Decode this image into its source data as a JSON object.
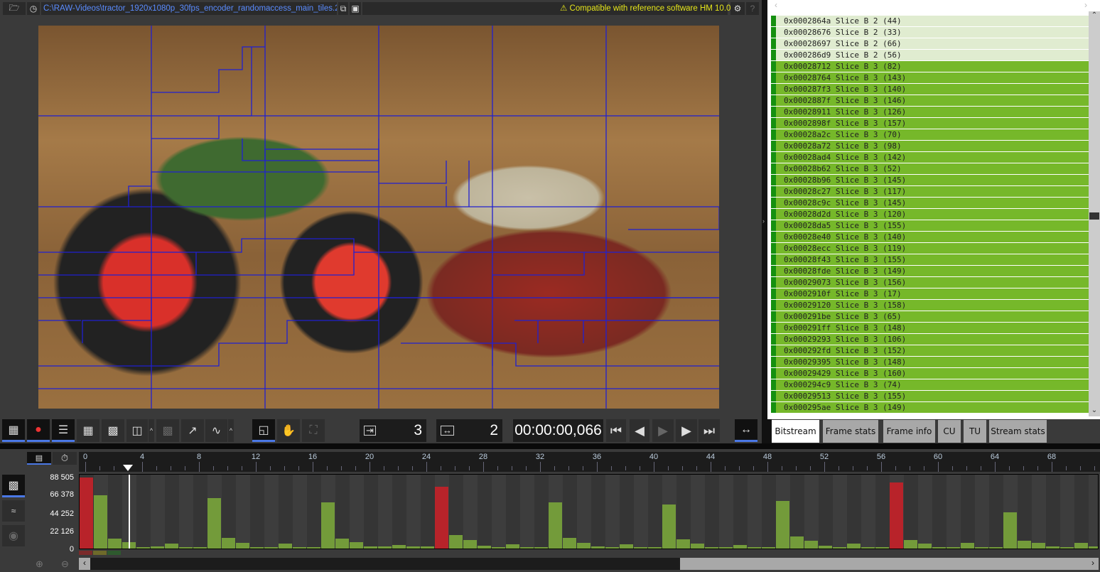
{
  "topbar": {
    "file_path": "C:\\RAW-Videos\\tractor_1920x1080p_30fps_encoder_randomaccess_main_tiles.265",
    "compat": "Compatible with reference software HM 10.0",
    "icons": [
      "folder-open-icon",
      "clock-icon",
      "copy-icon",
      "browse-icon",
      "warning-icon",
      "gear-icon",
      "help-icon"
    ]
  },
  "toolbar": {
    "frame_display": "3",
    "frame_coded": "2",
    "timecode": "00:00:00,066",
    "icons": [
      "motion-icon",
      "color-channels-icon",
      "slice-list-icon",
      "ctu-grid-icon",
      "cu-grid-icon",
      "prediction-icon",
      "block-pattern-icon",
      "vector-icon",
      "waveform-icon",
      "overlay-icon",
      "hand-icon",
      "fullscreen-icon",
      "first-frame-icon",
      "prev-frame-icon",
      "play-icon",
      "next-frame-icon",
      "last-frame-icon",
      "fit-icon"
    ]
  },
  "panel": {
    "rows": [
      {
        "text": "0x0002864a Slice B 2 (44)",
        "tid": 2
      },
      {
        "text": "0x00028676 Slice B 2 (33)",
        "tid": 2
      },
      {
        "text": "0x00028697 Slice B 2 (66)",
        "tid": 2
      },
      {
        "text": "0x000286d9 Slice B 2 (56)",
        "tid": 2
      },
      {
        "text": "0x00028712 Slice B 3 (82)",
        "tid": 3
      },
      {
        "text": "0x00028764 Slice B 3 (143)",
        "tid": 3
      },
      {
        "text": "0x000287f3 Slice B 3 (140)",
        "tid": 3
      },
      {
        "text": "0x0002887f Slice B 3 (146)",
        "tid": 3
      },
      {
        "text": "0x00028911 Slice B 3 (126)",
        "tid": 3
      },
      {
        "text": "0x0002898f Slice B 3 (157)",
        "tid": 3
      },
      {
        "text": "0x00028a2c Slice B 3 (70)",
        "tid": 3
      },
      {
        "text": "0x00028a72 Slice B 3 (98)",
        "tid": 3
      },
      {
        "text": "0x00028ad4 Slice B 3 (142)",
        "tid": 3
      },
      {
        "text": "0x00028b62 Slice B 3 (52)",
        "tid": 3
      },
      {
        "text": "0x00028b96 Slice B 3 (145)",
        "tid": 3
      },
      {
        "text": "0x00028c27 Slice B 3 (117)",
        "tid": 3
      },
      {
        "text": "0x00028c9c Slice B 3 (145)",
        "tid": 3
      },
      {
        "text": "0x00028d2d Slice B 3 (120)",
        "tid": 3
      },
      {
        "text": "0x00028da5 Slice B 3 (155)",
        "tid": 3
      },
      {
        "text": "0x00028e40 Slice B 3 (140)",
        "tid": 3
      },
      {
        "text": "0x00028ecc Slice B 3 (119)",
        "tid": 3
      },
      {
        "text": "0x00028f43 Slice B 3 (155)",
        "tid": 3
      },
      {
        "text": "0x00028fde Slice B 3 (149)",
        "tid": 3
      },
      {
        "text": "0x00029073 Slice B 3 (156)",
        "tid": 3
      },
      {
        "text": "0x0002910f Slice B 3 (17)",
        "tid": 3
      },
      {
        "text": "0x00029120 Slice B 3 (158)",
        "tid": 3
      },
      {
        "text": "0x000291be Slice B 3 (65)",
        "tid": 3
      },
      {
        "text": "0x000291ff Slice B 3 (148)",
        "tid": 3
      },
      {
        "text": "0x00029293 Slice B 3 (106)",
        "tid": 3
      },
      {
        "text": "0x000292fd Slice B 3 (152)",
        "tid": 3
      },
      {
        "text": "0x00029395 Slice B 3 (148)",
        "tid": 3
      },
      {
        "text": "0x00029429 Slice B 3 (160)",
        "tid": 3
      },
      {
        "text": "0x000294c9 Slice B 3 (74)",
        "tid": 3
      },
      {
        "text": "0x00029513 Slice B 3 (155)",
        "tid": 3
      },
      {
        "text": "0x000295ae Slice B 3 (149)",
        "tid": 3
      }
    ],
    "tabs": [
      {
        "label": "Bitstream",
        "active": true
      },
      {
        "label": "Frame stats"
      },
      {
        "label": "Frame info"
      },
      {
        "label": "CU"
      },
      {
        "label": "TU"
      },
      {
        "label": "Stream stats"
      }
    ]
  },
  "colors": {
    "intra": "#b8232a",
    "inter": "#739b3a",
    "accent": "#4a78e6",
    "row_light": "#e0ecd0",
    "row_dark": "#76b82a"
  },
  "chart_data": {
    "type": "bar",
    "y_ticks": [
      "88 505",
      "66 378",
      "44 252",
      "22 126",
      "0"
    ],
    "ylim": [
      0,
      88505
    ],
    "x_ticks": [
      "0",
      "4",
      "8",
      "12",
      "16",
      "20",
      "24",
      "28",
      "32",
      "36",
      "40",
      "44",
      "48",
      "52",
      "56",
      "60",
      "64",
      "68"
    ],
    "current_frame": 3,
    "values": [
      88505,
      66000,
      12400,
      8000,
      1800,
      2700,
      6200,
      1800,
      1800,
      62800,
      13300,
      7100,
      1800,
      1800,
      6200,
      1800,
      1800,
      57500,
      12400,
      8000,
      2700,
      2700,
      4400,
      2700,
      2700,
      77000,
      16800,
      10600,
      3500,
      1800,
      5300,
      1800,
      1800,
      57500,
      13300,
      7100,
      2700,
      1800,
      5300,
      1800,
      1800,
      54900,
      11500,
      6200,
      1800,
      1800,
      4400,
      1800,
      1800,
      59300,
      15000,
      9700,
      3500,
      1800,
      6200,
      1800,
      1800,
      82300,
      10600,
      6200,
      1800,
      1800,
      7100,
      1800,
      1800,
      45100,
      9700,
      7100,
      2700,
      1800,
      7100,
      2700
    ],
    "intra_frames": [
      0,
      25,
      57
    ]
  }
}
